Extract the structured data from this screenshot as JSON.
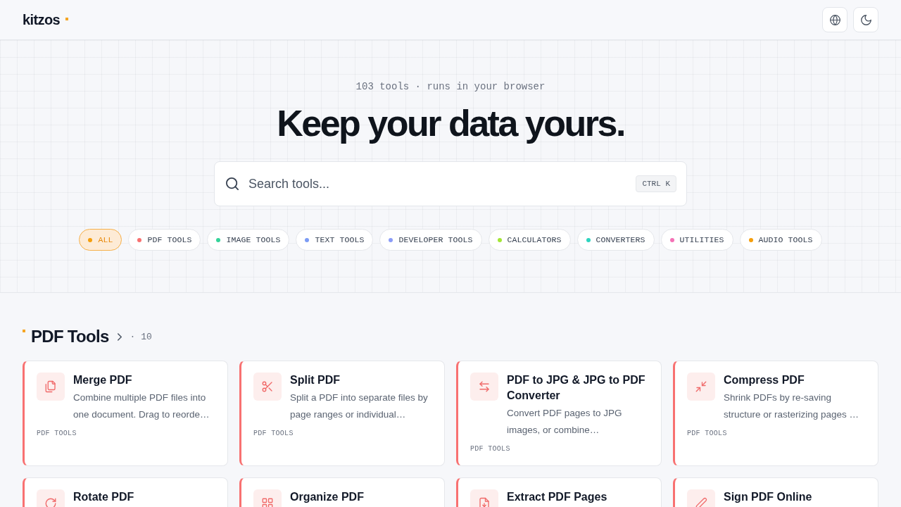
{
  "header": {
    "logo": "kitzos"
  },
  "hero": {
    "caption": "103 tools · runs in your browser",
    "title": "Keep your data yours.",
    "search": {
      "placeholder": "Search tools...",
      "shortcut": "CTRL K"
    }
  },
  "categories": [
    {
      "label": "ALL",
      "color": "#f59e0b",
      "selected": true
    },
    {
      "label": "PDF TOOLS",
      "color": "#f87171",
      "selected": false
    },
    {
      "label": "IMAGE TOOLS",
      "color": "#34d399",
      "selected": false
    },
    {
      "label": "TEXT TOOLS",
      "color": "#7c9cf5",
      "selected": false
    },
    {
      "label": "DEVELOPER TOOLS",
      "color": "#8b9cf7",
      "selected": false
    },
    {
      "label": "CALCULATORS",
      "color": "#a3e635",
      "selected": false
    },
    {
      "label": "CONVERTERS",
      "color": "#2dd4bf",
      "selected": false
    },
    {
      "label": "UTILITIES",
      "color": "#f472b6",
      "selected": false
    },
    {
      "label": "AUDIO TOOLS",
      "color": "#f59e0b",
      "selected": false
    }
  ],
  "sections": [
    {
      "title": "PDF Tools",
      "count": "· 10",
      "tools": [
        {
          "title": "Merge PDF",
          "description": "Combine multiple PDF files into one document. Drag to reorde…",
          "tag": "PDF TOOLS"
        },
        {
          "title": "Split PDF",
          "description": "Split a PDF into separate files by page ranges or individual…",
          "tag": "PDF TOOLS"
        },
        {
          "title": "PDF to JPG & JPG to PDF Converter",
          "description": "Convert PDF pages to JPG images, or combine…",
          "tag": "PDF TOOLS"
        },
        {
          "title": "Compress PDF",
          "description": "Shrink PDFs by re-saving structure or rasterizing pages …",
          "tag": "PDF TOOLS"
        },
        {
          "title": "Rotate PDF"
        },
        {
          "title": "Organize PDF"
        },
        {
          "title": "Extract PDF Pages"
        },
        {
          "title": "Sign PDF Online"
        }
      ]
    }
  ]
}
